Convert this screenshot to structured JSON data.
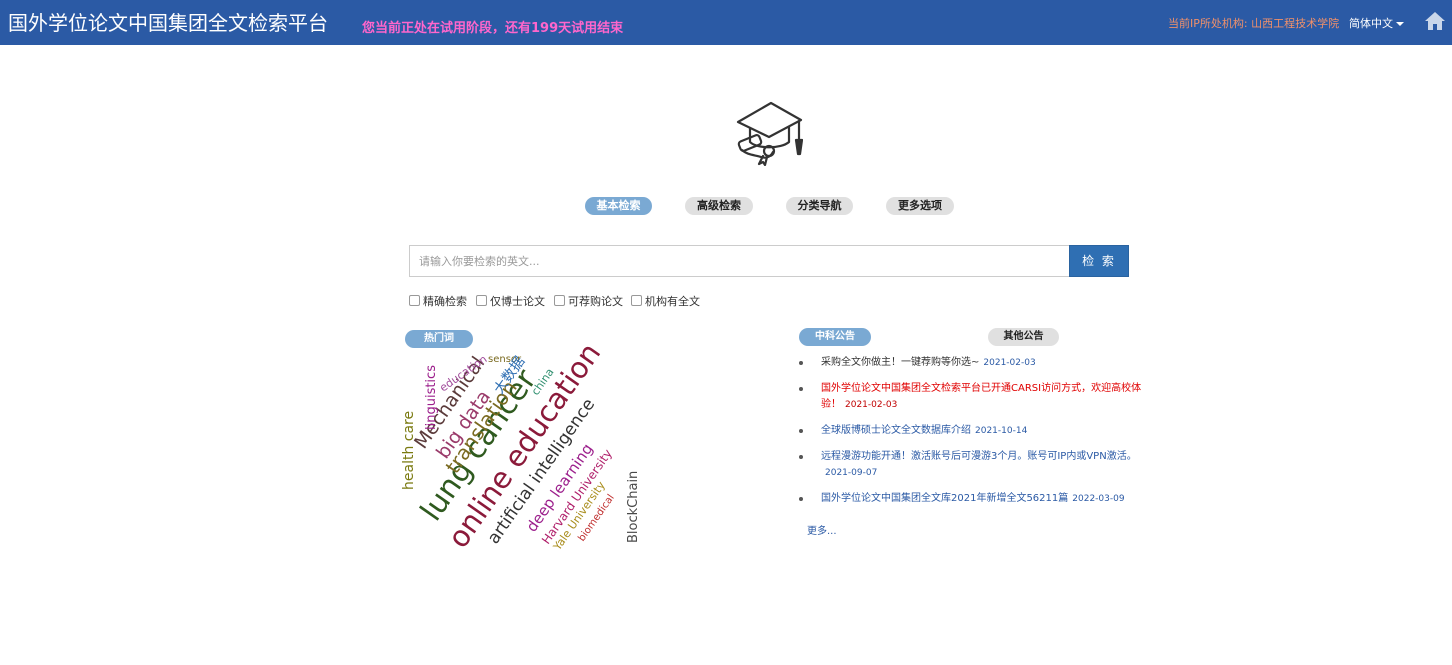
{
  "header": {
    "title": "国外学位论文中国集团全文检索平台",
    "trial_notice": "您当前正处在试用阶段，还有199天试用结束",
    "ip_institution": "当前IP所处机构: 山西工程技术学院",
    "language": "简体中文"
  },
  "tabs": [
    {
      "label": "基本检索",
      "active": true
    },
    {
      "label": "高级检索",
      "active": false
    },
    {
      "label": "分类导航",
      "active": false
    },
    {
      "label": "更多选项",
      "active": false
    }
  ],
  "search": {
    "placeholder": "请输入你要检索的英文...",
    "button_label": "检 索"
  },
  "options": [
    "精确检索",
    "仅博士论文",
    "可荐购论文",
    "机构有全文"
  ],
  "hot_words": {
    "label": "热门词",
    "words": [
      "online education",
      "lung cancer",
      "translation",
      "big data",
      "Mechanical",
      "artificial intelligence",
      "deep learning",
      "Harvard University",
      "Yale University",
      "biomedical",
      "BlockChain",
      "health care",
      "linguistics",
      "education",
      "sensor",
      "大数据",
      "china"
    ]
  },
  "announcements": {
    "tab_primary": "中科公告",
    "tab_secondary": "其他公告",
    "items": [
      {
        "text": "采购全文你做主！一键荐购等你选~",
        "date": "2021-02-03"
      },
      {
        "text": "国外学位论文中国集团全文检索平台已开通CARSI访问方式，欢迎高校体验！",
        "date": "2021-02-03"
      },
      {
        "text": "全球版博硕士论文全文数据库介绍",
        "date": "2021-10-14"
      },
      {
        "text": "远程漫游功能开通！激活账号后可漫游3个月。账号可IP内或VPN激活。",
        "date": "2021-09-07"
      },
      {
        "text": "国外学位论文中国集团全文库2021年新增全文56211篇",
        "date": "2022-03-09"
      }
    ],
    "more": "更多..."
  },
  "colors": {
    "header_bg": "#2b5aa5",
    "trial_text": "#ff66cc",
    "active_tab": "#7aa9d3",
    "search_button": "#2f6fb3"
  }
}
